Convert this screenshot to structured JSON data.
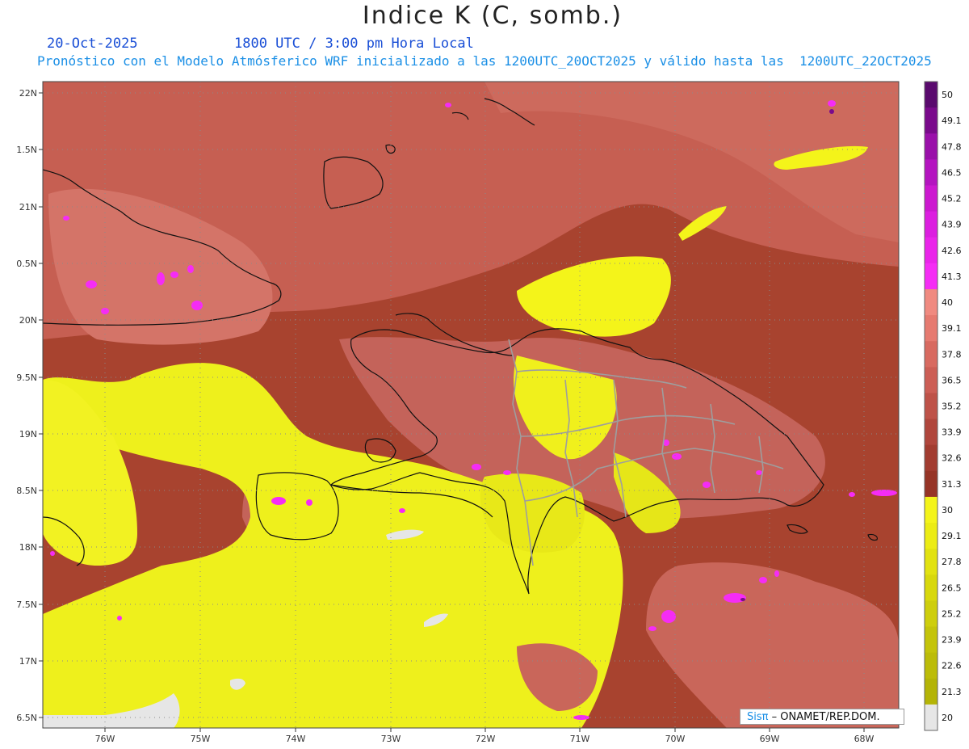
{
  "header": {
    "title": "Indice K (C, somb.)",
    "date": "20-Oct-2025",
    "valid_time": "1800 UTC / 3:00 pm Hora Local",
    "model_line": "Pronóstico con el Modelo Atmósferico WRF inicializado a las 1200UTC_20OCT2025 y válido hasta las  1200UTC_22OCT2025"
  },
  "map": {
    "lat_labels": [
      "22N",
      "1.5N",
      "21N",
      "0.5N",
      "20N",
      "9.5N",
      "19N",
      "8.5N",
      "18N",
      "7.5N",
      "17N",
      "6.5N"
    ],
    "lon_labels": [
      "76W",
      "75W",
      "74W",
      "73W",
      "72W",
      "71W",
      "70W",
      "69W",
      "68W"
    ]
  },
  "colorbar": {
    "labels": [
      "50",
      "49.1",
      "47.8",
      "46.5",
      "45.2",
      "43.9",
      "42.6",
      "41.3",
      "40",
      "39.1",
      "37.8",
      "36.5",
      "35.2",
      "33.9",
      "32.6",
      "31.3",
      "30",
      "29.1",
      "27.8",
      "26.5",
      "25.2",
      "23.9",
      "22.6",
      "21.3",
      "20"
    ],
    "colors": [
      "#5a0a6e",
      "#7a0a8c",
      "#9a10aa",
      "#b414c0",
      "#cc18d0",
      "#dc1ee0",
      "#ea24ea",
      "#f52cf5",
      "#f08a80",
      "#e67a70",
      "#d86a60",
      "#cc5e55",
      "#be5248",
      "#b0463c",
      "#a23c30",
      "#963426",
      "#f4f41a",
      "#ecec14",
      "#e2e210",
      "#d8d80c",
      "#cece0c",
      "#c4c40a",
      "#bcbc08",
      "#b4b406",
      "#e6e6e6"
    ]
  },
  "credit": {
    "brand": "Sisπ",
    "text": "– ONAMET/REP.DOM."
  }
}
